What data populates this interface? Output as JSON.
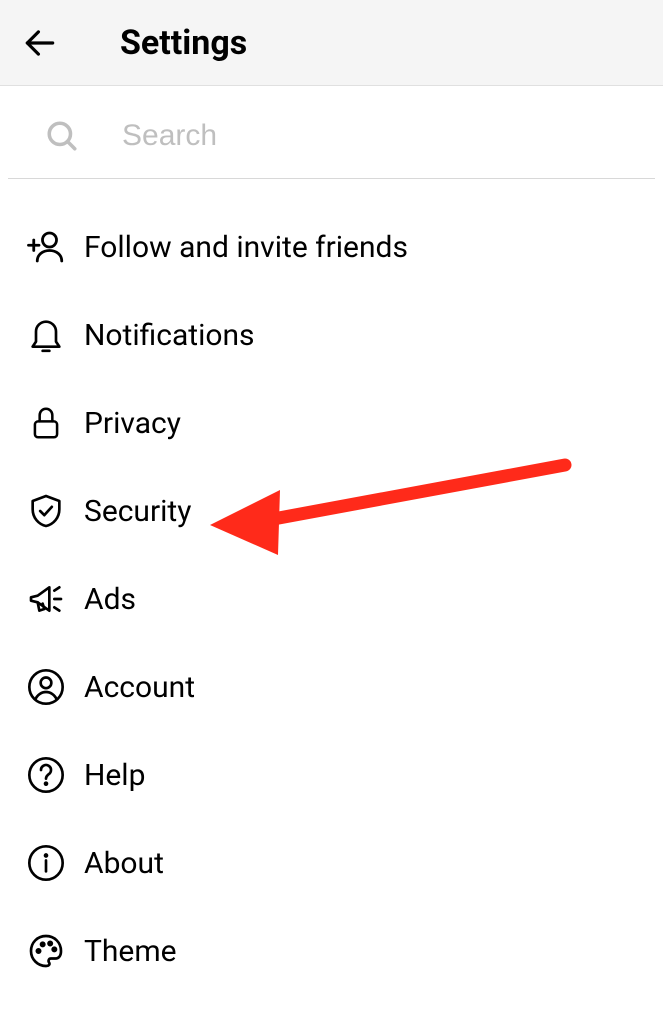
{
  "header": {
    "title": "Settings"
  },
  "search": {
    "placeholder": "Search"
  },
  "menu": {
    "items": [
      {
        "label": "Follow and invite friends"
      },
      {
        "label": "Notifications"
      },
      {
        "label": "Privacy"
      },
      {
        "label": "Security"
      },
      {
        "label": "Ads"
      },
      {
        "label": "Account"
      },
      {
        "label": "Help"
      },
      {
        "label": "About"
      },
      {
        "label": "Theme"
      }
    ]
  },
  "annotation": {
    "color": "#ff2a1a"
  }
}
